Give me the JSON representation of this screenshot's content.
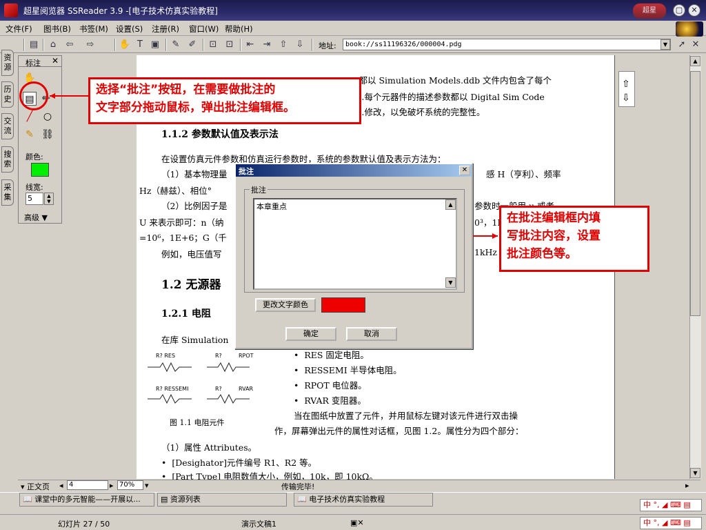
{
  "window": {
    "title": "超星阅览器 SSReader 3.9 -[电子技术仿真实验教程]"
  },
  "menu": [
    "文件(F)",
    "图书(B)",
    "书签(M)",
    "设置(S)",
    "注册(R)",
    "窗口(W)",
    "帮助(H)"
  ],
  "address": {
    "label": "地址:",
    "value": "book://ss11196326/000004.pdg"
  },
  "side_tabs": [
    "资源",
    "历史",
    "交流",
    "搜索",
    "采集"
  ],
  "panel": {
    "title": "标注",
    "color_label": "颜色:",
    "color": "#00ee00",
    "linewidth_label": "线宽:",
    "linewidth": "5",
    "advanced": "高级 ▼"
  },
  "doc": {
    "lines": [
      "…都以 Simulation Models.ddb 文件内包含了每个",
      "…每个元器件的描述参数都以 Digital Sim Code",
      "…修改，以免破坏系统的完整性。",
      "1.1.2   参数默认值及表示法",
      "在设置仿真元件参数和仿真运行参数时，系统的参数默认值及表示方法为：",
      "（1）基本物理量",
      "感 H（亨利）、频率",
      "Hz（赫兹）、相位°",
      "（2）比例因子是",
      "参数时一般用 u 或者",
      "U 来表示即可：n（纳",
      "0³，1E",
      "=10⁶，1E+6；G（千",
      "例如，电压值写",
      "1kHz",
      "1.2   无源器",
      "1.2.1   电阻",
      "在库 Simulation",
      "RES        固定电阻。",
      "RESSEMI      半导体电阻。",
      "RPOT       电位器。",
      "RVAR       变阻器。",
      "当在图纸中放置了元件，并用鼠标左键对该元件进行双击操",
      "作，屏幕弹出元件的属性对话框，见图 1.2。属性分为四个部分：",
      "图 1.1   电阻元件",
      "（1）属性 Attributes。",
      "[Desighator]元件编号 R1、R2 等。",
      "[Part Type] 电阻数值大小，例如，10k，即 10kΩ。"
    ],
    "resistors": [
      "R?  RES",
      "R?",
      "RPOT",
      "R?  RESSEMI",
      "R?",
      "RVAR"
    ]
  },
  "dialog": {
    "title": "批注",
    "group_label": "批注",
    "text": "本章重点",
    "change_color_button": "更改文字颜色",
    "color": "#ee0000",
    "ok_button": "确定",
    "cancel_button": "取消"
  },
  "callouts": {
    "left": "选择“批注”按钮，在需要做批注的\n文字部分拖动鼠标，弹出批注编辑框。",
    "right": "在批注编辑框内填\n写批注内容，设置\n批注颜色等。"
  },
  "bottom": {
    "page_label": "▾ 正文页",
    "page": "4",
    "zoom": "70%",
    "status": "传输完毕!"
  },
  "tasks": [
    "课堂中的多元智能——开展以...",
    "资源列表",
    "电子技术仿真实验教程"
  ],
  "statusbar": {
    "slide": "幻灯片 27 / 50",
    "doc": "演示文稿1"
  },
  "brand": "超星"
}
